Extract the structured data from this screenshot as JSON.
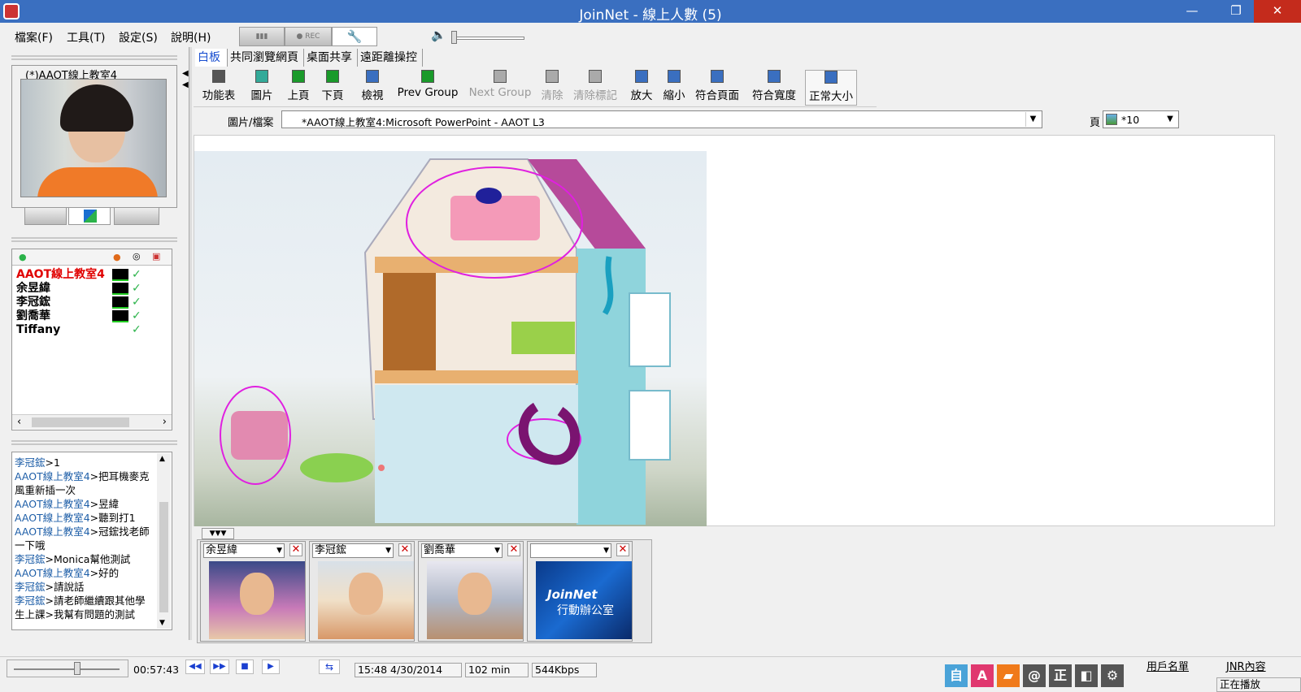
{
  "window": {
    "title": "JoinNet - 線上人數 (5)",
    "minimize": "—",
    "maximize": "❐",
    "close": "✕"
  },
  "menu": [
    "檔案(F)",
    "工具(T)",
    "設定(S)",
    "說明(H)"
  ],
  "toolbar_top": {
    "rec": "● REC"
  },
  "presenter": {
    "name": "(*)AAOT線上教室4"
  },
  "participants": [
    {
      "name": "AAOT線上教室4",
      "color": "#e00000"
    },
    {
      "name": "余昱緯",
      "color": "#000000"
    },
    {
      "name": "李冠鋐",
      "color": "#000000"
    },
    {
      "name": "劉喬華",
      "color": "#000000"
    },
    {
      "name": "Tiffany",
      "color": "#000000"
    }
  ],
  "check": "✓",
  "chat": [
    {
      "who": "李冠鋐",
      "msg": ">1"
    },
    {
      "who": "AAOT線上教室4",
      "msg": ">把耳機麥克風重新插一次"
    },
    {
      "who": "AAOT線上教室4",
      "msg": ">昱緯"
    },
    {
      "who": "AAOT線上教室4",
      "msg": ">聽到打1"
    },
    {
      "who": "AAOT線上教室4",
      "msg": ">冠鋐找老師一下哦"
    },
    {
      "who": "李冠鋐",
      "msg": ">Monica幫他測試"
    },
    {
      "who": "AAOT線上教室4",
      "msg": ">好的"
    },
    {
      "who": "李冠鋐",
      "msg": ">請說話"
    },
    {
      "who": "李冠鋐",
      "msg": ">請老師繼續跟其他學生上課>我幫有問題的測試"
    }
  ],
  "tabs": [
    "白板",
    "共同瀏覽網頁",
    "桌面共享",
    "遠距離操控"
  ],
  "tools": [
    {
      "label": "功能表",
      "disabled": false
    },
    {
      "label": "圖片",
      "disabled": false
    },
    {
      "label": "上頁",
      "disabled": false
    },
    {
      "label": "下頁",
      "disabled": false
    },
    {
      "label": "檢視",
      "disabled": false
    },
    {
      "label": "Prev Group",
      "disabled": false
    },
    {
      "label": "Next Group",
      "disabled": true
    },
    {
      "label": "清除",
      "disabled": true
    },
    {
      "label": "清除標記",
      "disabled": true
    },
    {
      "label": "放大",
      "disabled": false
    },
    {
      "label": "縮小",
      "disabled": false
    },
    {
      "label": "符合頁面",
      "disabled": false
    },
    {
      "label": "符合寬度",
      "disabled": false
    },
    {
      "label": "正常大小",
      "disabled": false
    }
  ],
  "file_bar": {
    "label": "圖片/檔案",
    "value": "*AAOT線上教室4:Microsoft PowerPoint - AAOT L3",
    "page_label": "頁",
    "page_value": "*10"
  },
  "video_collapse": "▼▼▼",
  "videos": [
    {
      "name": "余昱緯",
      "caption": ""
    },
    {
      "name": "李冠鋐",
      "caption": ""
    },
    {
      "name": "劉喬華",
      "caption": ""
    },
    {
      "name": "",
      "caption": "JoinNet",
      "caption2": "行動辦公室"
    }
  ],
  "status": {
    "elapsed": "00:57:43",
    "time": "15:48 4/30/2014",
    "duration": "102 min",
    "bandwidth": "544Kbps",
    "userlist": "用戶名單",
    "jnr": "JNR內容",
    "playing": "正在播放"
  },
  "tray": [
    {
      "glyph": "自",
      "color": "#4aa3d8"
    },
    {
      "glyph": "A",
      "color": "#e0386f"
    },
    {
      "glyph": "▰",
      "color": "#f07a1a"
    },
    {
      "glyph": "@",
      "color": "#555555"
    },
    {
      "glyph": "正",
      "color": "#555555"
    },
    {
      "glyph": "◧",
      "color": "#555555"
    },
    {
      "glyph": "⚙",
      "color": "#555555"
    }
  ]
}
